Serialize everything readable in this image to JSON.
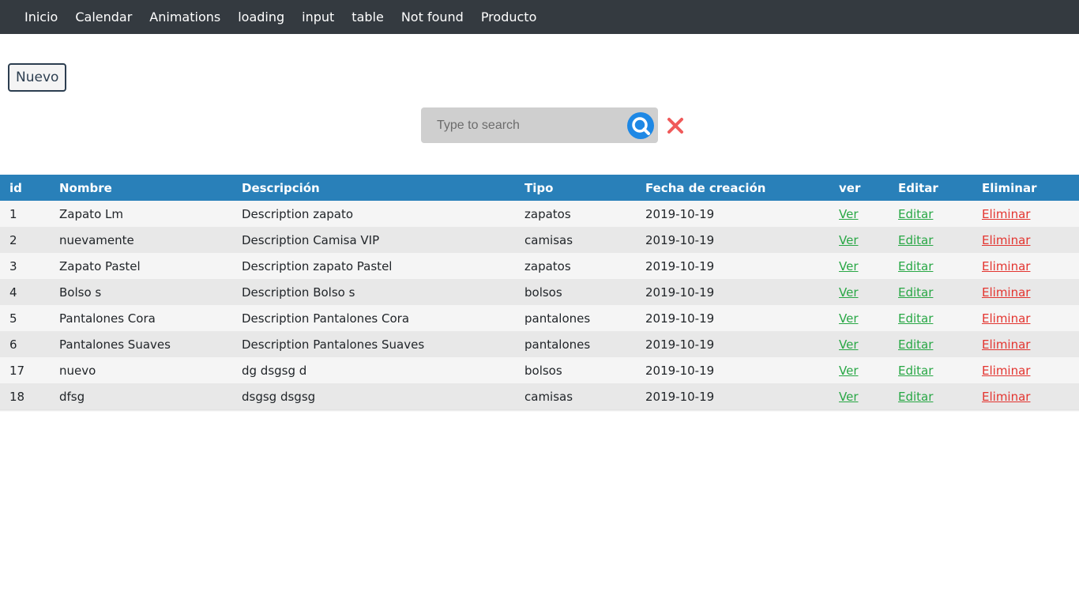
{
  "nav": {
    "items": [
      "Inicio",
      "Calendar",
      "Animations",
      "loading",
      "input",
      "table",
      "Not found",
      "Producto"
    ]
  },
  "toolbar": {
    "new_label": "Nuevo"
  },
  "search": {
    "placeholder": "Type to search",
    "value": ""
  },
  "colors": {
    "navbar": "#343a40",
    "header": "#2980b9",
    "link_green": "#28a745",
    "link_red": "#e3342f",
    "search_icon": "#1e88e5",
    "clear_icon": "#f05a5a"
  },
  "icons": {
    "search": "search-icon",
    "clear": "close-icon"
  },
  "table": {
    "columns": [
      "id",
      "Nombre",
      "Descripción",
      "Tipo",
      "Fecha de creación",
      "ver",
      "Editar",
      "Eliminar"
    ],
    "rows": [
      {
        "id": "1",
        "nombre": "Zapato Lm",
        "descripcion": "Description zapato",
        "tipo": "zapatos",
        "fecha": "2019-10-19",
        "ver": "Ver",
        "editar": "Editar",
        "eliminar": "Eliminar"
      },
      {
        "id": "2",
        "nombre": "nuevamente",
        "descripcion": "Description Camisa VIP",
        "tipo": "camisas",
        "fecha": "2019-10-19",
        "ver": "Ver",
        "editar": "Editar",
        "eliminar": "Eliminar"
      },
      {
        "id": "3",
        "nombre": "Zapato Pastel",
        "descripcion": "Description zapato Pastel",
        "tipo": "zapatos",
        "fecha": "2019-10-19",
        "ver": "Ver",
        "editar": "Editar",
        "eliminar": "Eliminar"
      },
      {
        "id": "4",
        "nombre": "Bolso s",
        "descripcion": "Description Bolso s",
        "tipo": "bolsos",
        "fecha": "2019-10-19",
        "ver": "Ver",
        "editar": "Editar",
        "eliminar": "Eliminar"
      },
      {
        "id": "5",
        "nombre": "Pantalones Cora",
        "descripcion": "Description Pantalones Cora",
        "tipo": "pantalones",
        "fecha": "2019-10-19",
        "ver": "Ver",
        "editar": "Editar",
        "eliminar": "Eliminar"
      },
      {
        "id": "6",
        "nombre": "Pantalones Suaves",
        "descripcion": "Description Pantalones Suaves",
        "tipo": "pantalones",
        "fecha": "2019-10-19",
        "ver": "Ver",
        "editar": "Editar",
        "eliminar": "Eliminar"
      },
      {
        "id": "17",
        "nombre": "nuevo",
        "descripcion": "dg dsgsg d",
        "tipo": "bolsos",
        "fecha": "2019-10-19",
        "ver": "Ver",
        "editar": "Editar",
        "eliminar": "Eliminar"
      },
      {
        "id": "18",
        "nombre": "dfsg",
        "descripcion": "dsgsg dsgsg",
        "tipo": "camisas",
        "fecha": "2019-10-19",
        "ver": "Ver",
        "editar": "Editar",
        "eliminar": "Eliminar"
      }
    ]
  }
}
